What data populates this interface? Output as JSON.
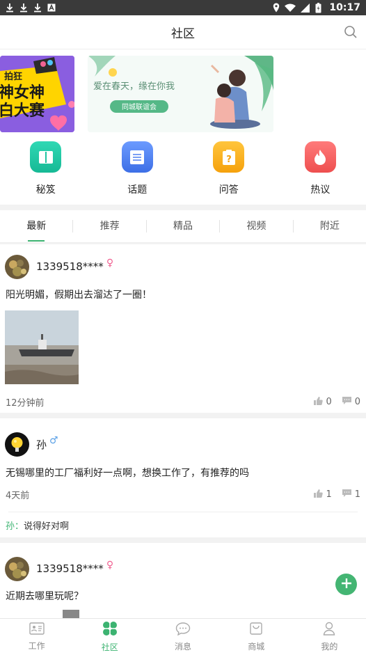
{
  "status_bar": {
    "time": "10:17"
  },
  "header": {
    "title": "社区"
  },
  "banners": [
    {
      "text_lines": [
        "拍狂",
        "神女神",
        "白大赛"
      ]
    },
    {
      "text": "爱在春天，缘在你我",
      "button": "同城联谊会"
    }
  ],
  "quick_menu": [
    {
      "label": "秘笈",
      "icon": "book-icon",
      "color": "#22c9a5"
    },
    {
      "label": "话题",
      "icon": "list-icon",
      "color": "#4f7ff0"
    },
    {
      "label": "问答",
      "icon": "question-icon",
      "color": "#f8b31e"
    },
    {
      "label": "热议",
      "icon": "flame-icon",
      "color": "#f26060"
    }
  ],
  "tabs": [
    "最新",
    "推荐",
    "精品",
    "视频",
    "附近"
  ],
  "active_tab": "最新",
  "posts": [
    {
      "user": "1339518****",
      "gender": "♀",
      "text": "阳光明媚，假期出去溜达了一圈！",
      "time": "12分钟前",
      "likes": "0",
      "comments": "0"
    },
    {
      "user": "孙",
      "gender": "♂",
      "text": "无锡哪里的工厂福利好一点啊，想换工作了，有推荐的吗",
      "time": "4天前",
      "likes": "1",
      "comments": "1",
      "reply": {
        "who": "孙：",
        "text": "说得好对啊"
      }
    },
    {
      "user": "1339518****",
      "gender": "♀",
      "text": "近期去哪里玩呢？"
    }
  ],
  "bottom_nav": [
    {
      "label": "工作",
      "icon": "work-icon"
    },
    {
      "label": "社区",
      "icon": "clover-icon"
    },
    {
      "label": "消息",
      "icon": "message-icon"
    },
    {
      "label": "商城",
      "icon": "shop-icon"
    },
    {
      "label": "我的",
      "icon": "user-icon"
    }
  ],
  "colors": {
    "accent": "#3cb371",
    "female": "#f06292",
    "male": "#5aa0e6"
  }
}
